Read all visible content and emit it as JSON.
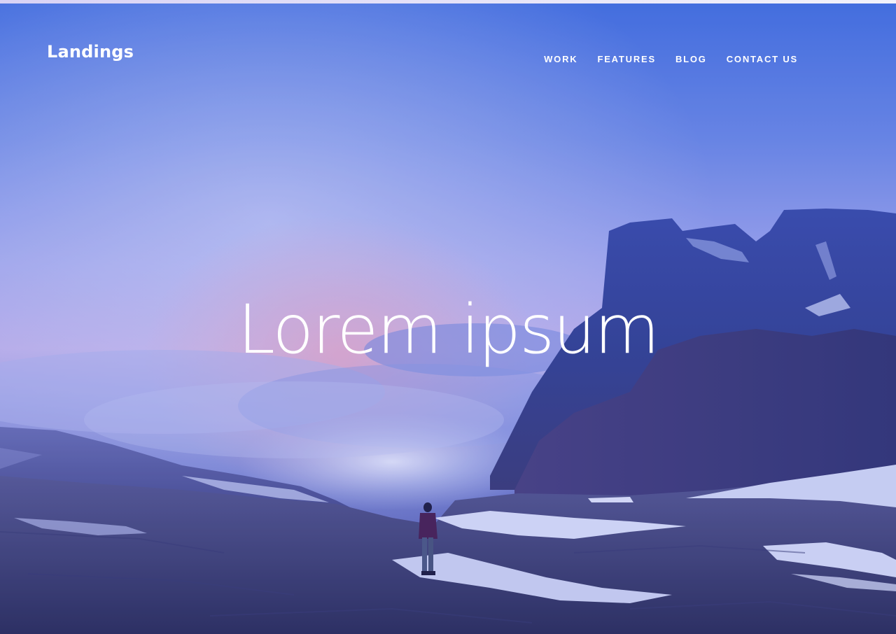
{
  "brand": {
    "name": "Landings"
  },
  "nav": {
    "items": [
      {
        "label": "WORK"
      },
      {
        "label": "FEATURES"
      },
      {
        "label": "BLOG"
      },
      {
        "label": "CONTACT US"
      }
    ]
  },
  "hero": {
    "title": "Lorem ipsum",
    "background": "mountain landscape with hiker and clouds"
  },
  "colors": {
    "overlay": "#5a6ee0",
    "text": "#ffffff",
    "sky_top": "#4a6fd8",
    "sky_glow": "#e8a9c9"
  }
}
